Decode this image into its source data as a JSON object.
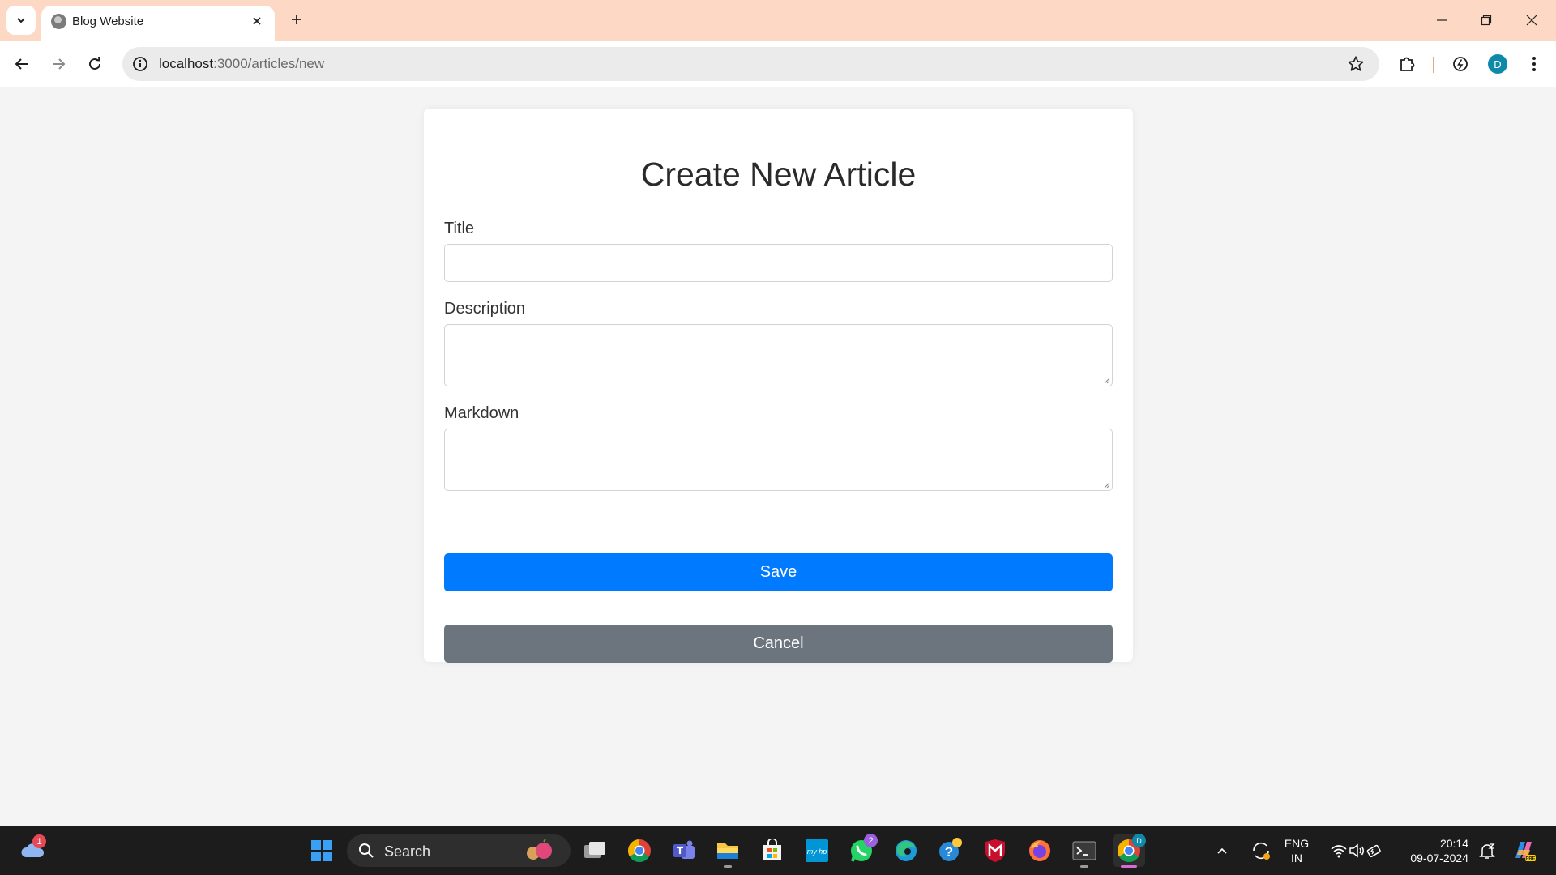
{
  "browser": {
    "tab_title": "Blog Website",
    "url_host": "localhost",
    "url_path": ":3000/articles/new",
    "profile_initial": "D"
  },
  "page": {
    "title": "Create New Article",
    "fields": {
      "title_label": "Title",
      "title_value": "",
      "description_label": "Description",
      "description_value": "",
      "markdown_label": "Markdown",
      "markdown_value": ""
    },
    "save_label": "Save",
    "cancel_label": "Cancel"
  },
  "colors": {
    "tabstrip": "#fdd9c5",
    "save_button": "#007bff",
    "cancel_button": "#6c757d",
    "page_background": "#f4f4f4",
    "taskbar": "#1c1c1c"
  },
  "taskbar": {
    "search_label": "Search",
    "weather_badge": "1",
    "whatsapp_badge": "2",
    "chrome_profile_badge": "D",
    "language_line1": "ENG",
    "language_line2": "IN",
    "time": "20:14",
    "date": "09-07-2024"
  }
}
